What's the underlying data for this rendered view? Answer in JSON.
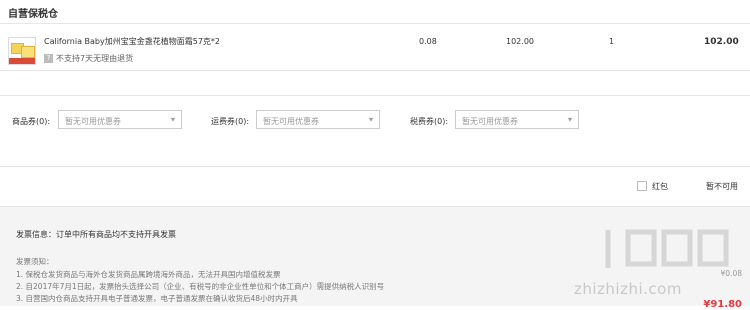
{
  "section": {
    "title": "自营保税仓"
  },
  "product": {
    "name": "California Baby加州宝宝金盏花植物面霜57克*2",
    "no_return": "不支持7天无理由退货",
    "tax": "0.08",
    "price": "102.00",
    "quantity": "1",
    "total": "102.00"
  },
  "coupons": [
    {
      "label": "商品券(0):",
      "placeholder": "暂无可用优惠券"
    },
    {
      "label": "运费券(0):",
      "placeholder": "暂无可用优惠券"
    },
    {
      "label": "税费券(0):",
      "placeholder": "暂无可用优惠券"
    }
  ],
  "hongbao": {
    "label": "红包",
    "value": "暂不可用"
  },
  "invoice": {
    "text": "发票信息：订单中所有商品均不支持开具发票"
  },
  "notes": {
    "title": "发票须知：",
    "items": [
      "1. 保税仓发货商品与海外仓发货商品属跨境海外商品，无法开具国内增值税发票",
      "2. 自2017年7月1日起，发票抬头选择公司（企业、有税号的非企业性单位和个体工商户）需提供纳税人识别号",
      "3. 自营国内仓商品支持开具电子普通发票，电子普通发票在确认收货后48小时内开具"
    ]
  },
  "summary": {
    "tax_value": "¥0.08",
    "pay_value": "¥91.80"
  },
  "watermark": {
    "url": "zhizhizhi.com"
  },
  "colors": {
    "accent": "#e4393c"
  }
}
